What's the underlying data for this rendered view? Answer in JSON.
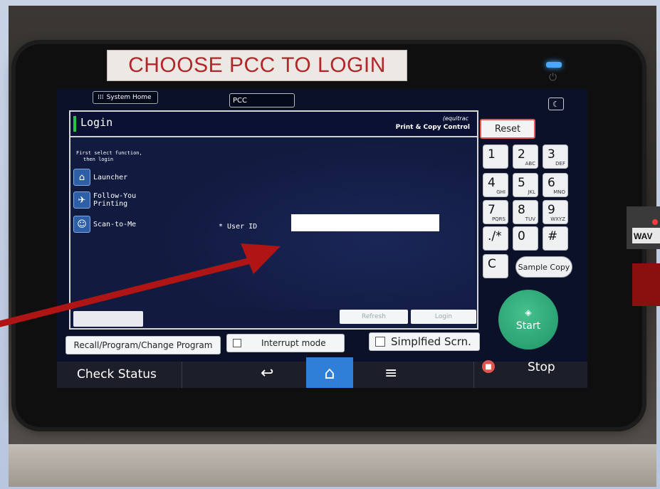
{
  "sticker": {
    "text": "CHOOSE PCC TO LOGIN"
  },
  "topbar": {
    "system_home": "System Home",
    "pcc_tab": "PCC"
  },
  "panel": {
    "title": "Login",
    "brand_small": "(equitrac",
    "brand_large": "Print & Copy Control",
    "hint": [
      "First select function,",
      "then login"
    ],
    "sidebar": [
      {
        "label": "Launcher"
      },
      {
        "label": "Follow-You Printing"
      },
      {
        "label": "Scan-to-Me"
      }
    ],
    "userid_label": "* User ID",
    "userid_value": "",
    "refresh_label": "Refresh",
    "login_label": "Login"
  },
  "keypad": {
    "reset": "Reset",
    "keys": [
      {
        "d": "1",
        "s": ""
      },
      {
        "d": "2",
        "s": "ABC"
      },
      {
        "d": "3",
        "s": "DEF"
      },
      {
        "d": "4",
        "s": "GHI"
      },
      {
        "d": "5",
        "s": "JKL"
      },
      {
        "d": "6",
        "s": "MNO"
      },
      {
        "d": "7",
        "s": "PQRS"
      },
      {
        "d": "8",
        "s": "TUV"
      },
      {
        "d": "9",
        "s": "WXYZ"
      },
      {
        "d": "./*",
        "s": ""
      },
      {
        "d": "0",
        "s": ""
      },
      {
        "d": "#",
        "s": ""
      }
    ],
    "clear": "C",
    "sample_copy": "Sample Copy",
    "start": "Start"
  },
  "options": {
    "recall": "Recall/Program/Change Program",
    "interrupt": "Interrupt mode",
    "simplified": "Simplfied Scrn."
  },
  "navbar": {
    "check_status": "Check Status",
    "stop": "Stop"
  },
  "colors": {
    "screen_bg": "#0b1129",
    "accent_blue": "#2f7ed8",
    "start_green": "#1f9466",
    "reset_border": "#e05b4e",
    "arrow": "#b01515",
    "sticker_text": "#b3262a"
  },
  "icons": {
    "system_home": "grid-icon",
    "launcher": "home-icon",
    "follow_you": "printer-icon",
    "scan_to_me": "person-icon",
    "back": "back-arrow-icon",
    "home": "home-icon",
    "menu": "menu-icon",
    "stop": "stop-icon",
    "sleep": "moon-icon"
  }
}
